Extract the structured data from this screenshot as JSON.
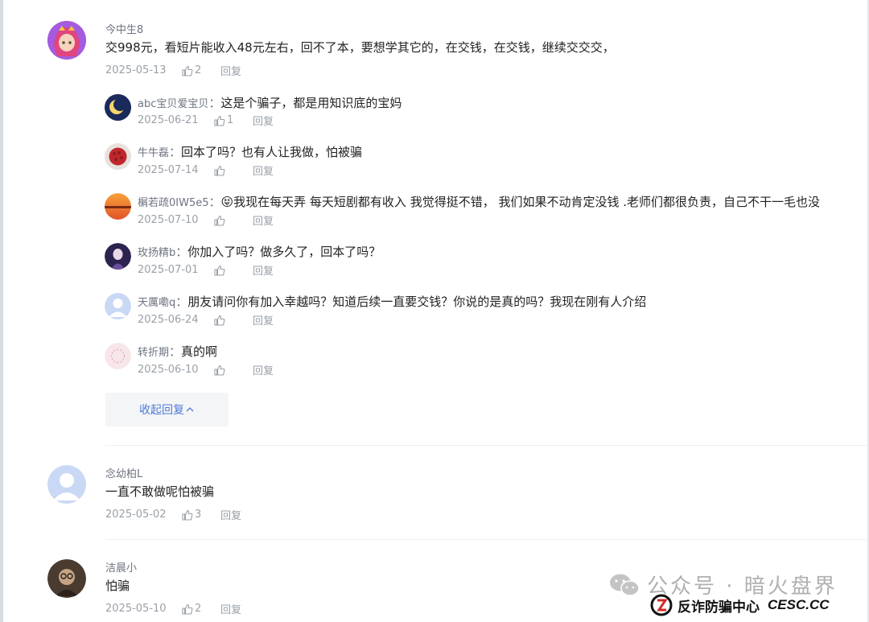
{
  "comments": [
    {
      "username": "今中生8",
      "text": "交998元，看短片能收入48元左右，回不了本，要想学其它的，在交钱，在交钱，继续交交交，",
      "date": "2025-05-13",
      "likes": "2",
      "reply_label": "回复",
      "avatar": "anime-girl-avatar",
      "replies": [
        {
          "username": "abc宝贝爱宝贝",
          "text": "这是个骗子，都是用知识底的宝妈",
          "date": "2025-06-21",
          "likes": "1",
          "reply_label": "回复",
          "avatar": "moon-avatar"
        },
        {
          "username": "牛牛磊",
          "text": "回本了吗？也有人让我做，怕被骗",
          "date": "2025-07-14",
          "likes": "",
          "reply_label": "回复",
          "avatar": "berries-avatar"
        },
        {
          "username": "榍若疏0IW5e5",
          "text": "我现在每天弄 每天短剧都有收入 我觉得挺不错， 我们如果不动肯定没钱 .老师们都很负责，自己不干一毛也没",
          "emoji": "😝",
          "date": "2025-07-10",
          "likes": "",
          "reply_label": "回复",
          "avatar": "sunset-avatar"
        },
        {
          "username": "玫扬精b",
          "text": "你加入了吗？做多久了，回本了吗？",
          "date": "2025-07-01",
          "likes": "",
          "reply_label": "回复",
          "avatar": "character-avatar"
        },
        {
          "username": "天厲嘞q",
          "text": "朋友请问你有加入幸越吗？知道后续一直要交钱？你说的是真的吗？我现在刚有人介绍",
          "date": "2025-06-24",
          "likes": "",
          "reply_label": "回复",
          "avatar": "default-avatar"
        },
        {
          "username": "转折期",
          "text": "真的啊",
          "date": "2025-06-10",
          "likes": "",
          "reply_label": "回复",
          "avatar": "pink-avatar"
        }
      ],
      "collapse_label": "收起回复"
    },
    {
      "username": "念幼柏L",
      "text": "一直不敢做呢怕被骗",
      "date": "2025-05-02",
      "likes": "3",
      "reply_label": "回复",
      "avatar": "default-avatar"
    },
    {
      "username": "洁晨小",
      "text": "怕骗",
      "date": "2025-05-10",
      "likes": "2",
      "reply_label": "回复",
      "avatar": "photo-avatar"
    }
  ],
  "watermark": {
    "text": "公众号 · 暗火盘界",
    "badge_text": "反诈防骗中心",
    "badge_site": "CESC.CC"
  },
  "colors": {
    "link_blue": "#4e7ad8",
    "meta_gray": "#9aa0a8",
    "name_gray": "#6d7480"
  }
}
